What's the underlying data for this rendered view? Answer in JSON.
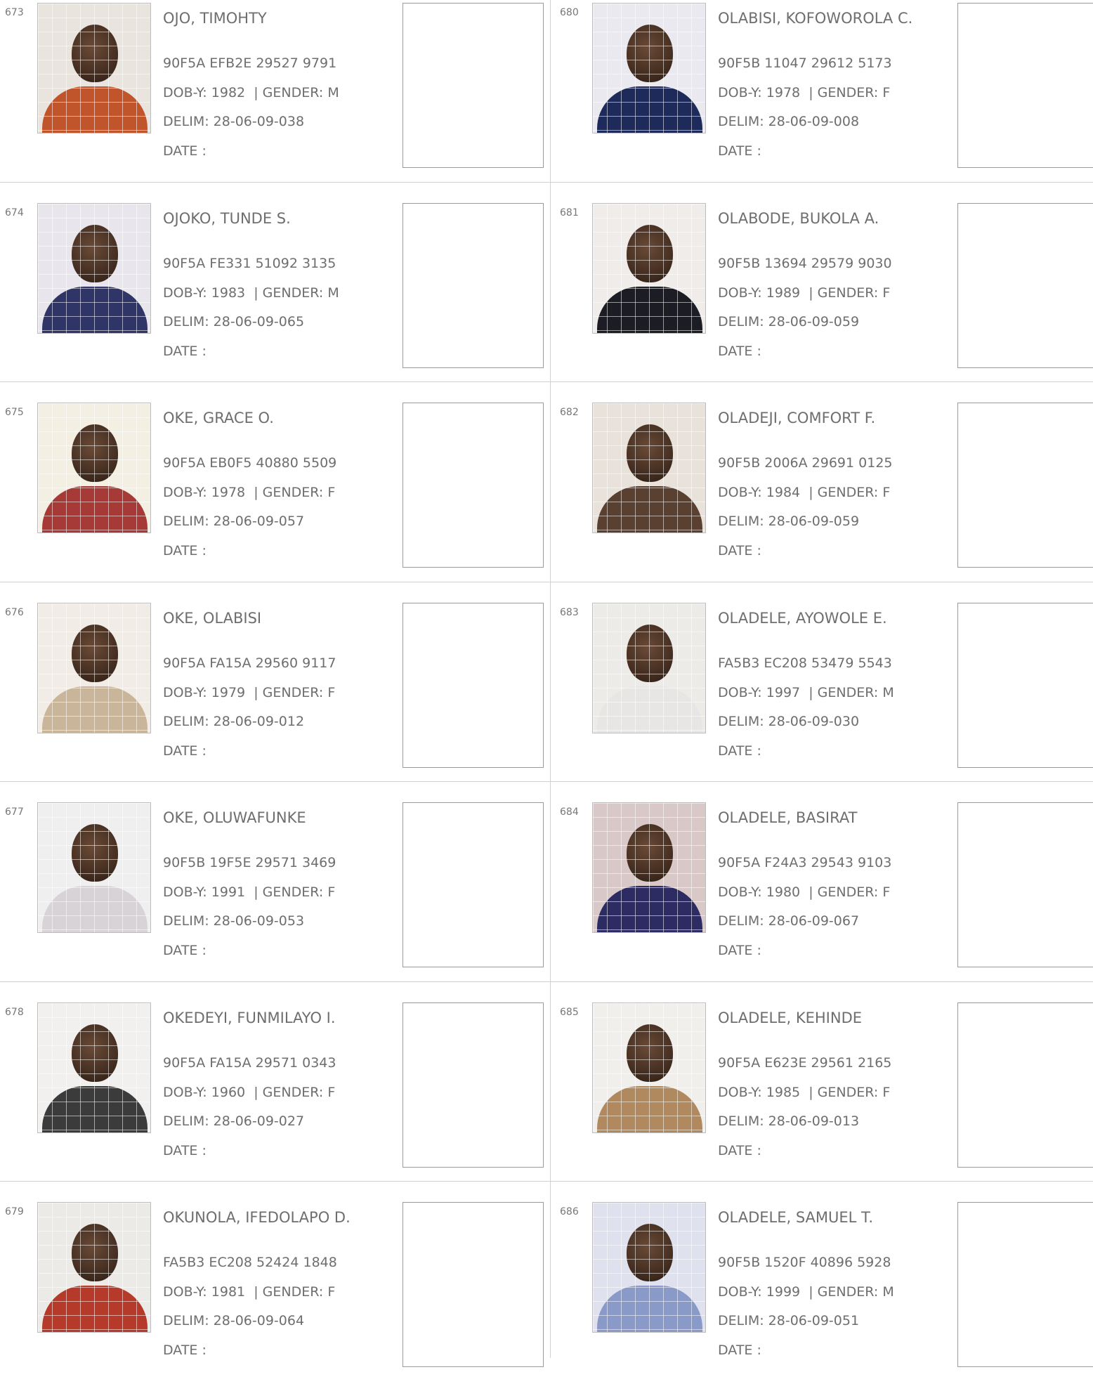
{
  "labels": {
    "dob_prefix": "DOB-Y:",
    "gender_prefix": "| GENDER:",
    "delim_prefix": "DELIM:",
    "date_label": "DATE :"
  },
  "left_column": [
    {
      "serial": "673",
      "name": "OJO, TIMOHTY",
      "id": "90F5A EFB2E 29527 9791",
      "dob": "1982",
      "gender": "M",
      "delim": "28-06-09-038"
    },
    {
      "serial": "674",
      "name": "OJOKO, TUNDE S.",
      "id": "90F5A FE331 51092 3135",
      "dob": "1983",
      "gender": "M",
      "delim": "28-06-09-065"
    },
    {
      "serial": "675",
      "name": "OKE, GRACE O.",
      "id": "90F5A EB0F5 40880 5509",
      "dob": "1978",
      "gender": "F",
      "delim": "28-06-09-057"
    },
    {
      "serial": "676",
      "name": "OKE, OLABISI",
      "id": "90F5A FA15A 29560 9117",
      "dob": "1979",
      "gender": "F",
      "delim": "28-06-09-012"
    },
    {
      "serial": "677",
      "name": "OKE, OLUWAFUNKE",
      "id": "90F5B 19F5E 29571 3469",
      "dob": "1991",
      "gender": "F",
      "delim": "28-06-09-053"
    },
    {
      "serial": "678",
      "name": "OKEDEYI, FUNMILAYO I.",
      "id": "90F5A FA15A 29571 0343",
      "dob": "1960",
      "gender": "F",
      "delim": "28-06-09-027"
    },
    {
      "serial": "679",
      "name": "OKUNOLA, IFEDOLAPO D.",
      "id": "FA5B3 EC208 52424 1848",
      "dob": "1981",
      "gender": "F",
      "delim": "28-06-09-064"
    }
  ],
  "right_column": [
    {
      "serial": "680",
      "name": "OLABISI, KOFOWOROLA C.",
      "id": "90F5B 11047 29612 5173",
      "dob": "1978",
      "gender": "F",
      "delim": "28-06-09-008"
    },
    {
      "serial": "681",
      "name": "OLABODE, BUKOLA A.",
      "id": "90F5B 13694 29579 9030",
      "dob": "1989",
      "gender": "F",
      "delim": "28-06-09-059"
    },
    {
      "serial": "682",
      "name": "OLADEJI, COMFORT F.",
      "id": "90F5B 2006A 29691 0125",
      "dob": "1984",
      "gender": "F",
      "delim": "28-06-09-059"
    },
    {
      "serial": "683",
      "name": "OLADELE, AYOWOLE E.",
      "id": "FA5B3 EC208 53479 5543",
      "dob": "1997",
      "gender": "M",
      "delim": "28-06-09-030"
    },
    {
      "serial": "684",
      "name": "OLADELE, BASIRAT",
      "id": "90F5A F24A3 29543 9103",
      "dob": "1980",
      "gender": "F",
      "delim": "28-06-09-067"
    },
    {
      "serial": "685",
      "name": "OLADELE, KEHINDE",
      "id": "90F5A E623E 29561 2165",
      "dob": "1985",
      "gender": "F",
      "delim": "28-06-09-013"
    },
    {
      "serial": "686",
      "name": "OLADELE, SAMUEL T.",
      "id": "90F5B 1520F 40896 5928",
      "dob": "1999",
      "gender": "M",
      "delim": "28-06-09-051"
    }
  ],
  "photo_palettes": [
    [
      "#e9e4de",
      "#c0552c"
    ],
    [
      "#e8e6ec",
      "#2f3566"
    ],
    [
      "#f3efe3",
      "#a63a36"
    ],
    [
      "#f1ece6",
      "#c8b59a"
    ],
    [
      "#efefef",
      "#d7d3d7"
    ],
    [
      "#f2f0ee",
      "#3b3b3b"
    ],
    [
      "#eceae6",
      "#b53a2a"
    ],
    [
      "#e9e9ef",
      "#1e2a5a"
    ],
    [
      "#f0ecea",
      "#1c1c24"
    ],
    [
      "#e8e2da",
      "#5a4030"
    ],
    [
      "#ecebe8",
      "#e8e6e4"
    ],
    [
      "#d9c8c8",
      "#2c2c62"
    ],
    [
      "#f1efec",
      "#b08a5e"
    ],
    [
      "#dfe2ee",
      "#8a9ac8"
    ]
  ]
}
